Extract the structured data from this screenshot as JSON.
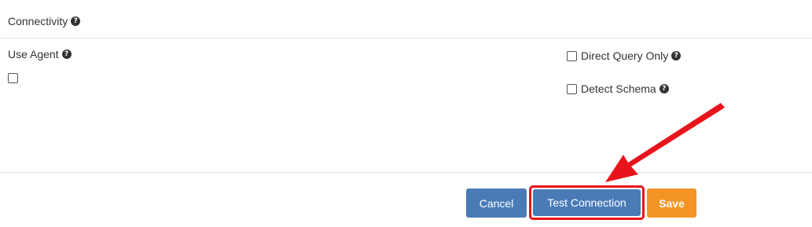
{
  "connectivity": {
    "title": "Connectivity",
    "help_icon": "question-circle-icon"
  },
  "agent": {
    "label": "Use Agent",
    "checked": false
  },
  "options": {
    "direct_query_label": "Direct Query Only",
    "direct_query_checked": false,
    "detect_schema_label": "Detect Schema",
    "detect_schema_checked": false
  },
  "footer": {
    "cancel_label": "Cancel",
    "test_label": "Test Connection",
    "save_label": "Save"
  },
  "colors": {
    "primary": "#4a7bb7",
    "save": "#f39425",
    "highlight": "#e8141c"
  },
  "annotation": {
    "icon": "red-arrow-icon"
  }
}
